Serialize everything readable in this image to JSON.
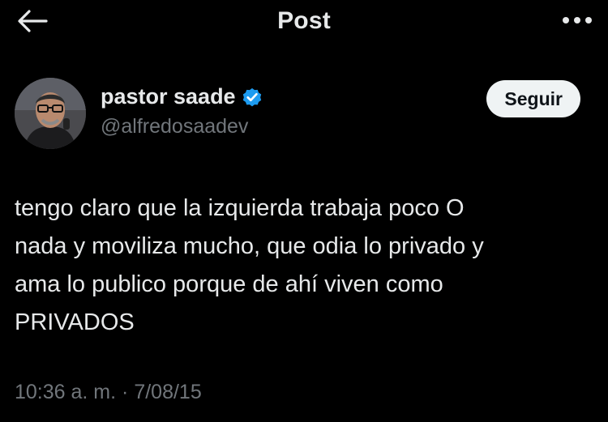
{
  "header": {
    "title": "Post",
    "back_icon": "arrow-left-icon",
    "more_icon": "more-horizontal-icon"
  },
  "author": {
    "display_name": "pastor saade",
    "handle": "@alfredosaadev",
    "verified_icon": "verified-badge-icon",
    "verified_color": "#1d9bf0",
    "follow_label": "Seguir"
  },
  "post": {
    "text": "tengo claro que la izquierda trabaja poco O\nnada y moviliza mucho, que odia lo privado y\nama lo publico porque de ahí viven como\nPRIVADOS",
    "time": "10:36 a. m.",
    "separator": "·",
    "date": "7/08/15"
  },
  "colors": {
    "background": "#000000",
    "primary_text": "#e7e9ea",
    "secondary_text": "#71767b",
    "follow_button_bg": "#eff3f4"
  }
}
